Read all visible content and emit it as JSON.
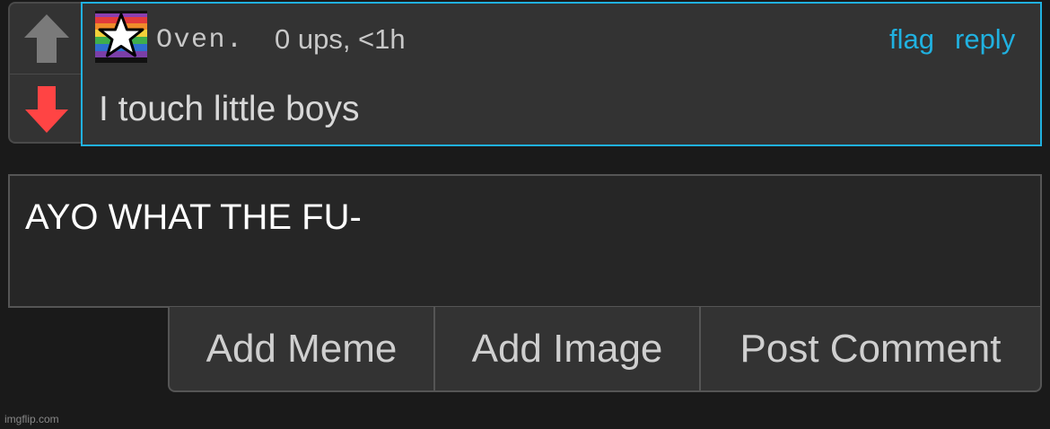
{
  "comment": {
    "username": "Oven.",
    "meta": "0 ups, <1h",
    "flag_label": "flag",
    "reply_label": "reply",
    "text": "I touch little boys"
  },
  "reply_box": {
    "value": "AYO WHAT THE FU-"
  },
  "buttons": {
    "add_meme": "Add Meme",
    "add_image": "Add Image",
    "post_comment": "Post Comment"
  },
  "watermark": "imgflip.com",
  "icons": {
    "upvote": "upvote-arrow-icon",
    "downvote": "downvote-arrow-icon",
    "avatar": "pride-star-avatar"
  },
  "colors": {
    "accent": "#20b1e0",
    "upvote": "#7a7a7a",
    "downvote": "#ff4444",
    "background": "#1a1a1a",
    "card": "#333333"
  }
}
